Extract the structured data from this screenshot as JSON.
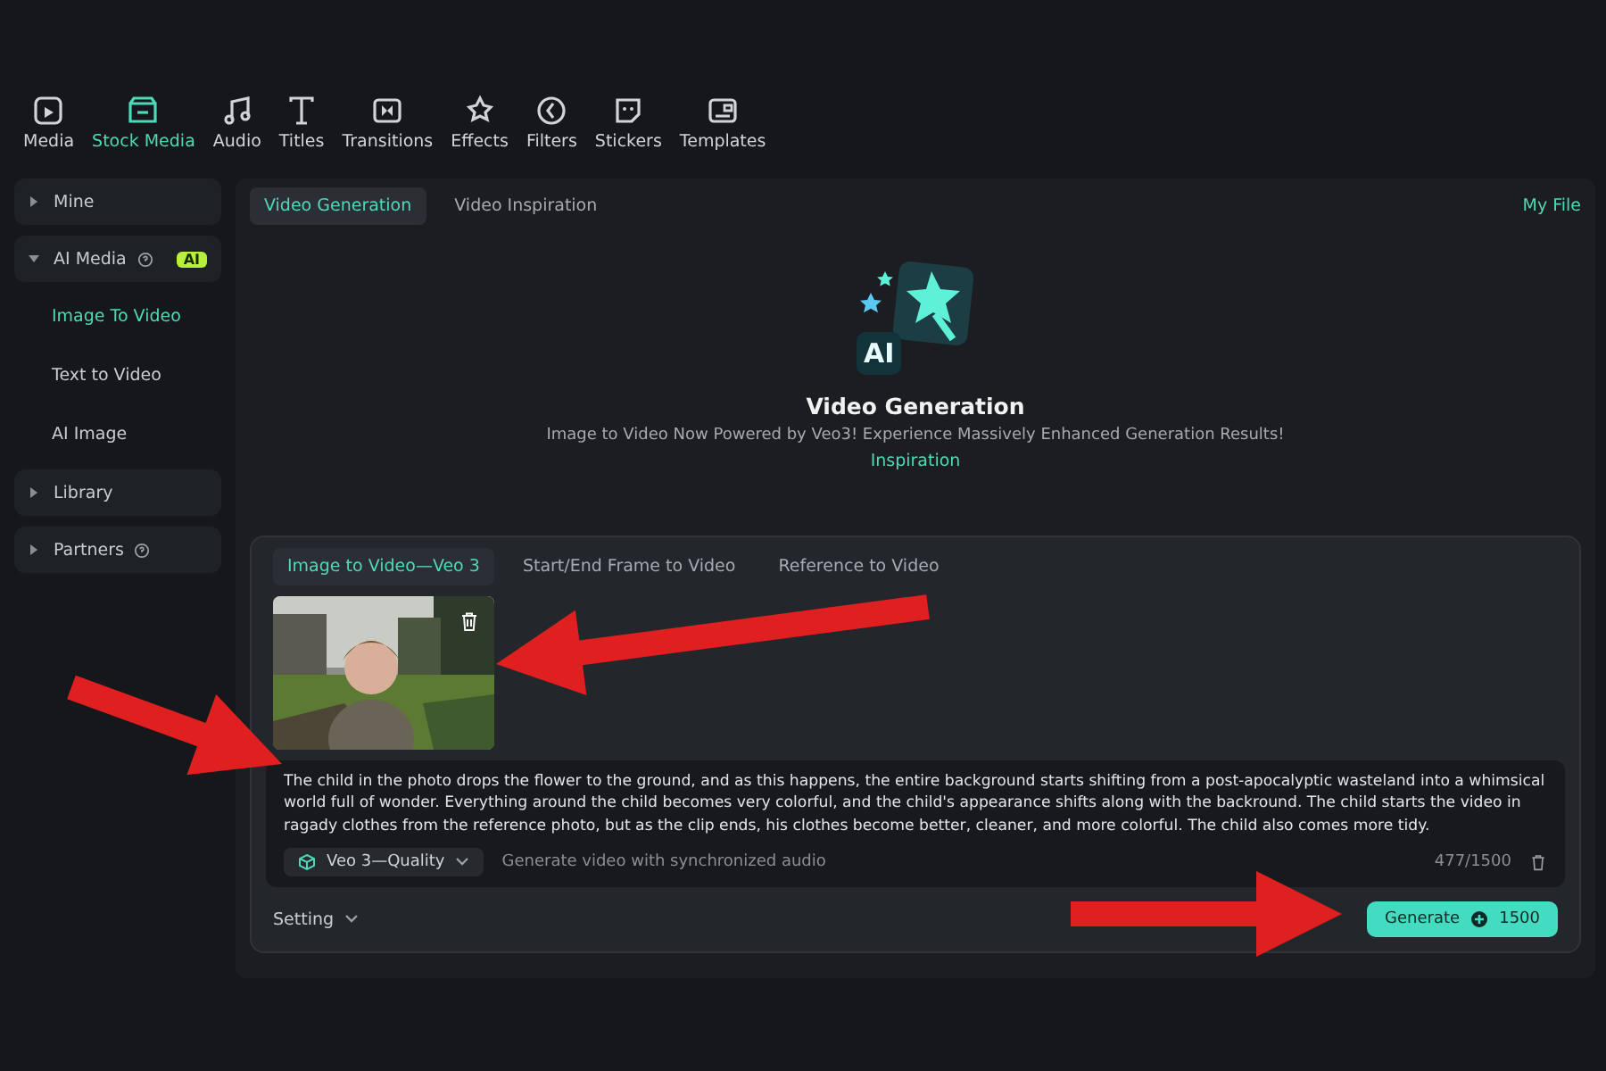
{
  "toolbar": [
    {
      "label": "Media",
      "selected": false
    },
    {
      "label": "Stock Media",
      "selected": true
    },
    {
      "label": "Audio",
      "selected": false
    },
    {
      "label": "Titles",
      "selected": false
    },
    {
      "label": "Transitions",
      "selected": false
    },
    {
      "label": "Effects",
      "selected": false
    },
    {
      "label": "Filters",
      "selected": false
    },
    {
      "label": "Stickers",
      "selected": false
    },
    {
      "label": "Templates",
      "selected": false
    }
  ],
  "sidebar": {
    "items": [
      {
        "label": "Mine",
        "expanded": false,
        "help": false
      },
      {
        "label": "AI Media",
        "expanded": true,
        "help": true,
        "badge": "AI",
        "children": [
          {
            "label": "Image To Video",
            "selected": true
          },
          {
            "label": "Text to Video",
            "selected": false
          },
          {
            "label": "AI Image",
            "selected": false
          }
        ]
      },
      {
        "label": "Library",
        "expanded": false,
        "help": false
      },
      {
        "label": "Partners",
        "expanded": false,
        "help": true
      }
    ]
  },
  "tabs": [
    {
      "label": "Video Generation",
      "selected": true
    },
    {
      "label": "Video Inspiration",
      "selected": false
    }
  ],
  "my_file": "My File",
  "hero": {
    "badge": "AI",
    "title": "Video Generation",
    "subtitle": "Image to Video Now Powered by Veo3! Experience Massively Enhanced Generation Results!",
    "link": "Inspiration"
  },
  "panel": {
    "tabs": [
      {
        "label": "Image to Video—Veo 3",
        "selected": true
      },
      {
        "label": "Start/End Frame to Video",
        "selected": false
      },
      {
        "label": "Reference to Video",
        "selected": false
      }
    ],
    "prompt": "The child in the photo drops the flower to the ground, and as this happens, the entire background starts shifting from a post-apocalyptic wasteland into a whimsical world full of wonder. Everything around the child becomes very colorful, and the child's appearance shifts along with the backround. The child starts the video in ragady clothes from the reference photo, but as the clip ends, his clothes become better, cleaner, and more colorful. The child also comes more tidy.",
    "model": "Veo 3—Quality",
    "audio_hint": "Generate video with synchronized audio",
    "counter": "477/1500",
    "setting": "Setting",
    "generate": {
      "label": "Generate",
      "credits": "1500"
    }
  }
}
